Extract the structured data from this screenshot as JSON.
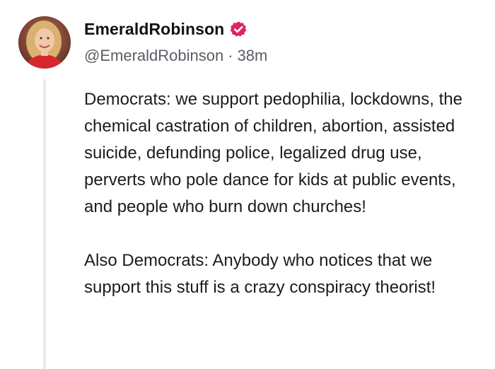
{
  "author": {
    "display_name": "EmeraldRobinson",
    "handle": "@EmeraldRobinson",
    "separator": "·",
    "timestamp": "38m",
    "verified_icon": "verified-badge-icon",
    "verified_color": "#e0245e"
  },
  "post": {
    "paragraphs": [
      "Democrats: we support pedophilia, lockdowns, the chemical castration of children, abortion, assisted suicide, defunding police, legalized drug use, perverts who pole dance for kids at public events, and people who burn down churches!",
      "Also Democrats: Anybody who notices that we support this stuff is a crazy conspiracy theorist!"
    ]
  }
}
